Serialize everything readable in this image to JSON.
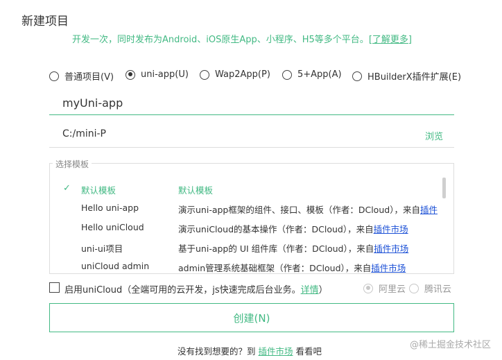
{
  "dialog": {
    "title": "新建项目",
    "subtitle": "开发一次，同时发布为Android、iOS原生App、小程序、H5等多个平台。",
    "learn_more": "[了解更多]"
  },
  "project_types": [
    {
      "label": "普通项目(V)",
      "checked": false
    },
    {
      "label": "uni-app(U)",
      "checked": true
    },
    {
      "label": "Wap2App(P)",
      "checked": false
    },
    {
      "label": "5+App(A)",
      "checked": false
    },
    {
      "label": "HBuilderX插件扩展(E)",
      "checked": false
    }
  ],
  "project_name": {
    "value": "myUni-app"
  },
  "project_path": {
    "value": "C:/mini-P",
    "browse_label": "浏览"
  },
  "templates": {
    "legend": "选择模板",
    "items": [
      {
        "name": "默认模板",
        "desc": "默认模板",
        "link": "",
        "selected": true
      },
      {
        "name": "Hello uni-app",
        "desc": "演示uni-app框架的组件、接口、模板（作者：DCloud），来自",
        "link": "插件",
        "selected": false
      },
      {
        "name": "Hello uniCloud",
        "desc": "演示uniCloud的基本操作（作者：DCloud），来自",
        "link": "插件市场",
        "selected": false
      },
      {
        "name": "uni-ui项目",
        "desc": "基于uni-app的 UI 组件库（作者：DCloud），来自",
        "link": "插件市场",
        "selected": false
      },
      {
        "name": "uniCloud admin",
        "desc": "admin管理系统基础框架（作者：DCloud），来自",
        "link": "插件市场",
        "selected": false
      }
    ]
  },
  "unicloud": {
    "label": "启用uniCloud",
    "desc": "（全端可用的云开发，js快速完成后台业务。",
    "detail": "详情",
    "close_paren": "）",
    "providers": [
      {
        "label": "阿里云",
        "checked": true
      },
      {
        "label": "腾讯云",
        "checked": false
      }
    ]
  },
  "create_button": "创建(N)",
  "footer": {
    "prefix": "没有找到想要的？到",
    "market": "插件市场",
    "suffix": "看看吧"
  },
  "watermark": "@稀土掘金技术社区",
  "colors": {
    "accent": "#42b983",
    "link": "#1a4fd6"
  }
}
